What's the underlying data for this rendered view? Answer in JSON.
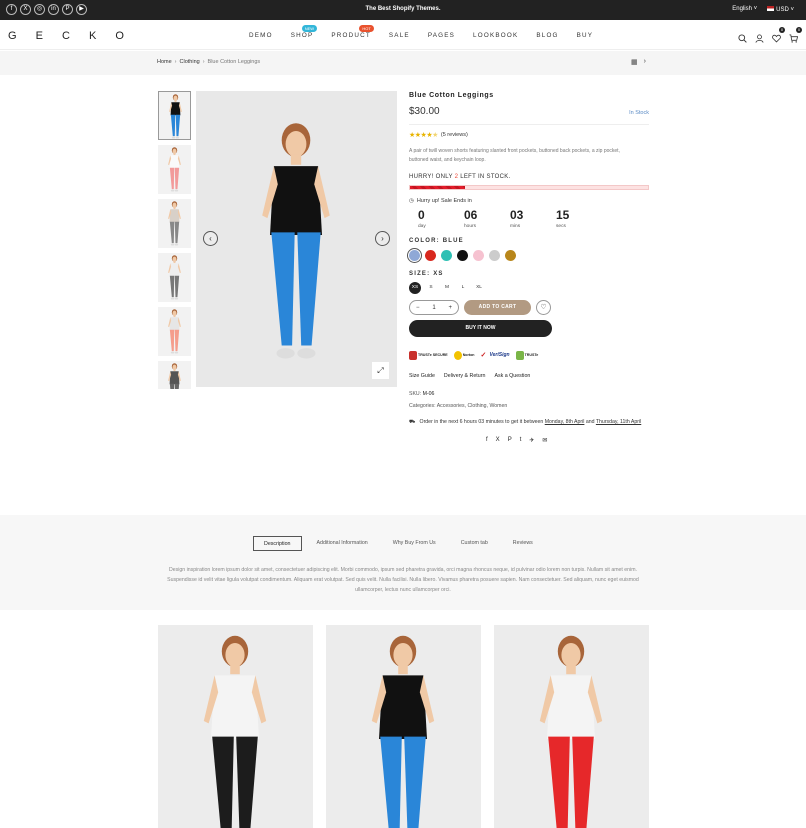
{
  "topbar": {
    "promo": "The Best Shopify Themes.",
    "language": "English",
    "currency": "USD",
    "social": [
      "f",
      "X",
      "◎",
      "in",
      "P",
      "▶"
    ]
  },
  "header": {
    "logo": "G E C K O",
    "nav": [
      {
        "label": "DEMO",
        "badge": ""
      },
      {
        "label": "SHOP",
        "badge": "NEW",
        "badge_color": "#32b6d9"
      },
      {
        "label": "PRODUCT",
        "badge": "HOT",
        "badge_color": "#e9522e"
      },
      {
        "label": "SALE",
        "badge": ""
      },
      {
        "label": "PAGES",
        "badge": ""
      },
      {
        "label": "LOOKBOOK",
        "badge": ""
      },
      {
        "label": "BLOG",
        "badge": ""
      },
      {
        "label": "BUY",
        "badge": ""
      }
    ],
    "wishlist_count": "0",
    "cart_count": "0"
  },
  "breadcrumb": {
    "home": "Home",
    "category": "Clothing",
    "current": "Blue Cotton Leggings"
  },
  "product": {
    "title": "Blue Cotton Leggings",
    "price": "$30.00",
    "stock": "In Stock",
    "rating": 4.5,
    "reviews": "(5 reviews)",
    "description": "A pair of twill woven shorts featuring slanted front pockets, buttoned back pockets, a zip pocket, buttoned waist, and keychain loop.",
    "hurry_prefix": "HURRY! ONLY",
    "hurry_count": "2",
    "hurry_suffix": "LEFT IN STOCK.",
    "stock_fill": 0.23,
    "sale_ends": "Hurry up! Sale Ends in",
    "countdown": [
      {
        "value": "0",
        "label": "day"
      },
      {
        "value": "06",
        "label": "hours"
      },
      {
        "value": "03",
        "label": "mins"
      },
      {
        "value": "15",
        "label": "secs"
      }
    ],
    "color_label": "COLOR: BLUE",
    "colors": [
      "#8fa8d6",
      "#d8281e",
      "#2fc0b4",
      "#111111",
      "#f6c2d0",
      "#cccccc",
      "#b8861a"
    ],
    "size_label": "SIZE: XS",
    "sizes": [
      "XS",
      "S",
      "M",
      "L",
      "XL"
    ],
    "quantity": "1",
    "add_to_cart": "ADD TO CART",
    "buy_now": "BUY IT NOW",
    "trust_badges": [
      "TRUSTe SECURE",
      "Norton",
      "VeriSign",
      "TRUSTe"
    ],
    "links": [
      "Size Guide",
      "Delivery & Return",
      "Ask a Question"
    ],
    "sku_label": "SKU:",
    "sku": "M-06",
    "categories_label": "Categories:",
    "categories": "Accessories, Clothing, Women",
    "order_text": "Order in the next 6 hours 03 minutes to get it between",
    "order_date1": "Monday, 8th April",
    "order_and": "and",
    "order_date2": "Thursday, 11th April",
    "share": [
      "f",
      "X",
      "P",
      "t",
      "✈",
      "✉"
    ]
  },
  "tabs": {
    "items": [
      "Description",
      "Additional Information",
      "Why Buy From Us",
      "Custom tab",
      "Reviews"
    ],
    "active": "Description",
    "content": "Design inspiration lorem ipsum dolor sit amet, consectetuer adipiscing elit. Morbi commodo, ipsum sed pharetra gravida, orci magna rhoncus neque, id pulvinar odio lorem non turpis. Nullam sit amet enim. Suspendisse id velit vitae ligula volutpat condimentum. Aliquam erat volutpat. Sed quis velit. Nulla facilisi. Nulla libero. Vivamus pharetra posuere sapien. Nam consectetuer. Sed aliquam, nunc eget euismod ullamcorper, lectus nunc ullamcorper orci."
  },
  "colors": {
    "accent": "#b29a82",
    "dark": "#222222",
    "stock_link": "#5b8bc5"
  }
}
